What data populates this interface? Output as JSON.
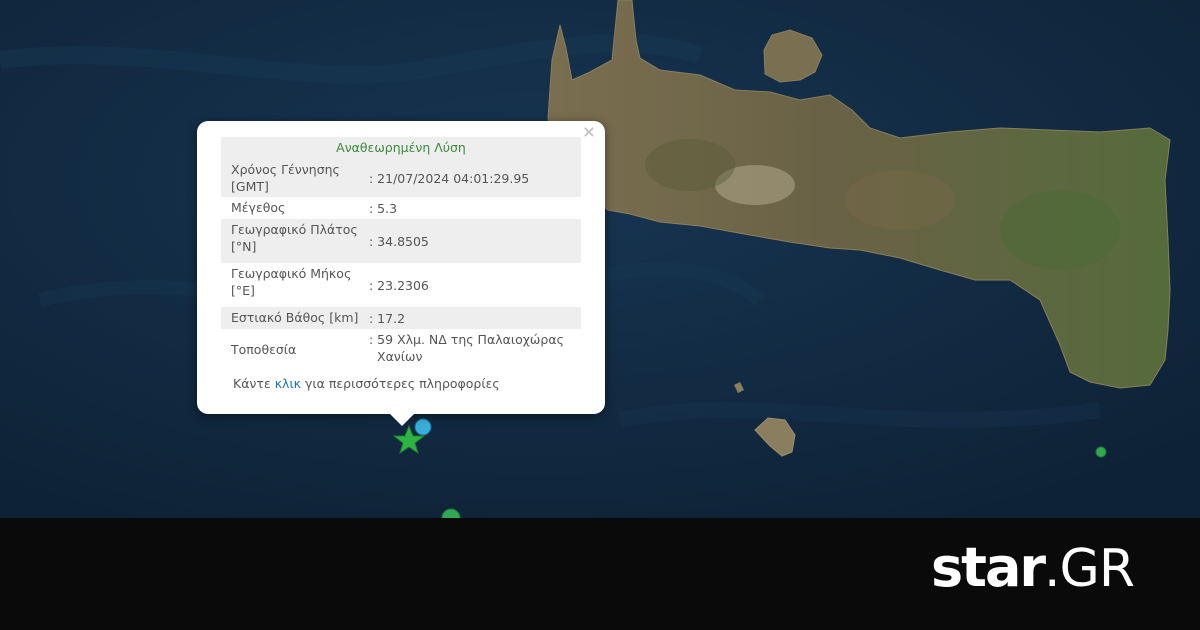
{
  "popup": {
    "title": "Αναθεωρημένη Λύση",
    "close_label": "×",
    "rows": [
      {
        "key_line1": "Χρόνος Γέννησης",
        "key_line2": "[GMT]",
        "value_line1": ": 21/07/2024 04:01:29.95",
        "value_line2": ""
      },
      {
        "key_line1": "Μέγεθος",
        "key_line2": "",
        "value_line1": ": 5.3",
        "value_line2": ""
      },
      {
        "key_line1": "Γεωγραφικό Πλάτος",
        "key_line2": "[°N]",
        "value_line1": ": 34.8505",
        "value_line2": ""
      },
      {
        "key_line1": "Γεωγραφικό Μήκος",
        "key_line2": "[°E]",
        "value_line1": ": 23.2306",
        "value_line2": ""
      },
      {
        "key_line1": "Εστιακό Βάθος [km]",
        "key_line2": "",
        "value_line1": ": 17.2",
        "value_line2": ""
      },
      {
        "key_line1": "Τοποθεσία",
        "key_line2": "",
        "value_line1": ": 59 Χλμ. ΝΔ της Παλαιοχώρας",
        "value_line2": "Χανίων"
      }
    ],
    "more_prefix": "Κάντε ",
    "more_link": "κλικ",
    "more_suffix": " για περισσότερες πληροφορίες"
  },
  "markers": {
    "epicenter_icon": "star-icon",
    "epicenter_color": "#2fb344",
    "preliminary_color": "#3aaedb",
    "other_color": "#33a852"
  },
  "brand": {
    "part1": "star",
    "part2": ".GR"
  },
  "colors": {
    "sea": "#11283f",
    "land": "#6e6548",
    "footer": "#0a0a0a"
  }
}
